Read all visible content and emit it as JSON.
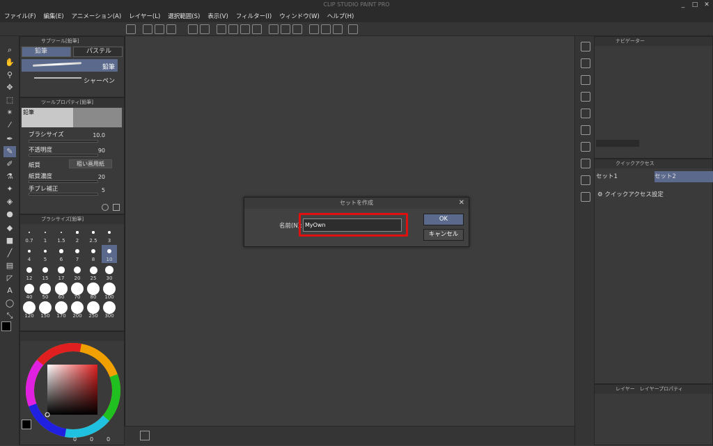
{
  "window": {
    "title": "CLIP STUDIO PAINT PRO",
    "controls": [
      "_",
      "□",
      "✕"
    ]
  },
  "menu": [
    "ファイル(F)",
    "編集(E)",
    "アニメーション(A)",
    "レイヤー(L)",
    "選択範囲(S)",
    "表示(V)",
    "フィルター(I)",
    "ウィンドウ(W)",
    "ヘルプ(H)"
  ],
  "subtool": {
    "header": "サブツール[鉛筆]",
    "tabs": [
      "鉛筆",
      "パステル"
    ],
    "items": [
      "鉛筆",
      "シャーペン"
    ]
  },
  "toolprop": {
    "header": "ツールプロパティ[鉛筆]",
    "preset_name": "鉛筆",
    "rows": [
      {
        "label": "ブラシサイズ",
        "value": "10.0"
      },
      {
        "label": "不透明度",
        "value": "90"
      },
      {
        "label": "紙質",
        "value": "粗い画用紙"
      },
      {
        "label": "紙質濃度",
        "value": "20"
      },
      {
        "label": "手ブレ補正",
        "value": "5"
      }
    ]
  },
  "brushsize": {
    "header": "ブラシサイズ[鉛筆]",
    "sizes": [
      "0.7",
      "1",
      "1.5",
      "2",
      "2.5",
      "3",
      "4",
      "5",
      "6",
      "7",
      "8",
      "10",
      "12",
      "15",
      "17",
      "20",
      "25",
      "30",
      "40",
      "50",
      "60",
      "70",
      "80",
      "100",
      "120",
      "150",
      "170",
      "200",
      "250",
      "300"
    ],
    "selected": "10"
  },
  "color": {
    "main": "#000000",
    "sub": "#ffffff",
    "wheel_hue": "#e02020",
    "footer_values": [
      "0",
      "0",
      "0"
    ]
  },
  "navigator": {
    "header": "ナビゲーター"
  },
  "quickaccess": {
    "header": "クイックアクセス",
    "sets": [
      "セット1",
      "セット2"
    ],
    "selected_set": "セット2",
    "settings_label": "クイックアクセス設定"
  },
  "layer": {
    "header": "レイヤー",
    "header2": "レイヤープロパティ"
  },
  "dialog": {
    "title": "セットを作成",
    "name_label": "名前(N):",
    "name_value": "MyOwn",
    "ok_label": "OK",
    "cancel_label": "キャンセル"
  },
  "colors": {
    "accent": "#5b6a8c",
    "highlight": "#e01010"
  }
}
